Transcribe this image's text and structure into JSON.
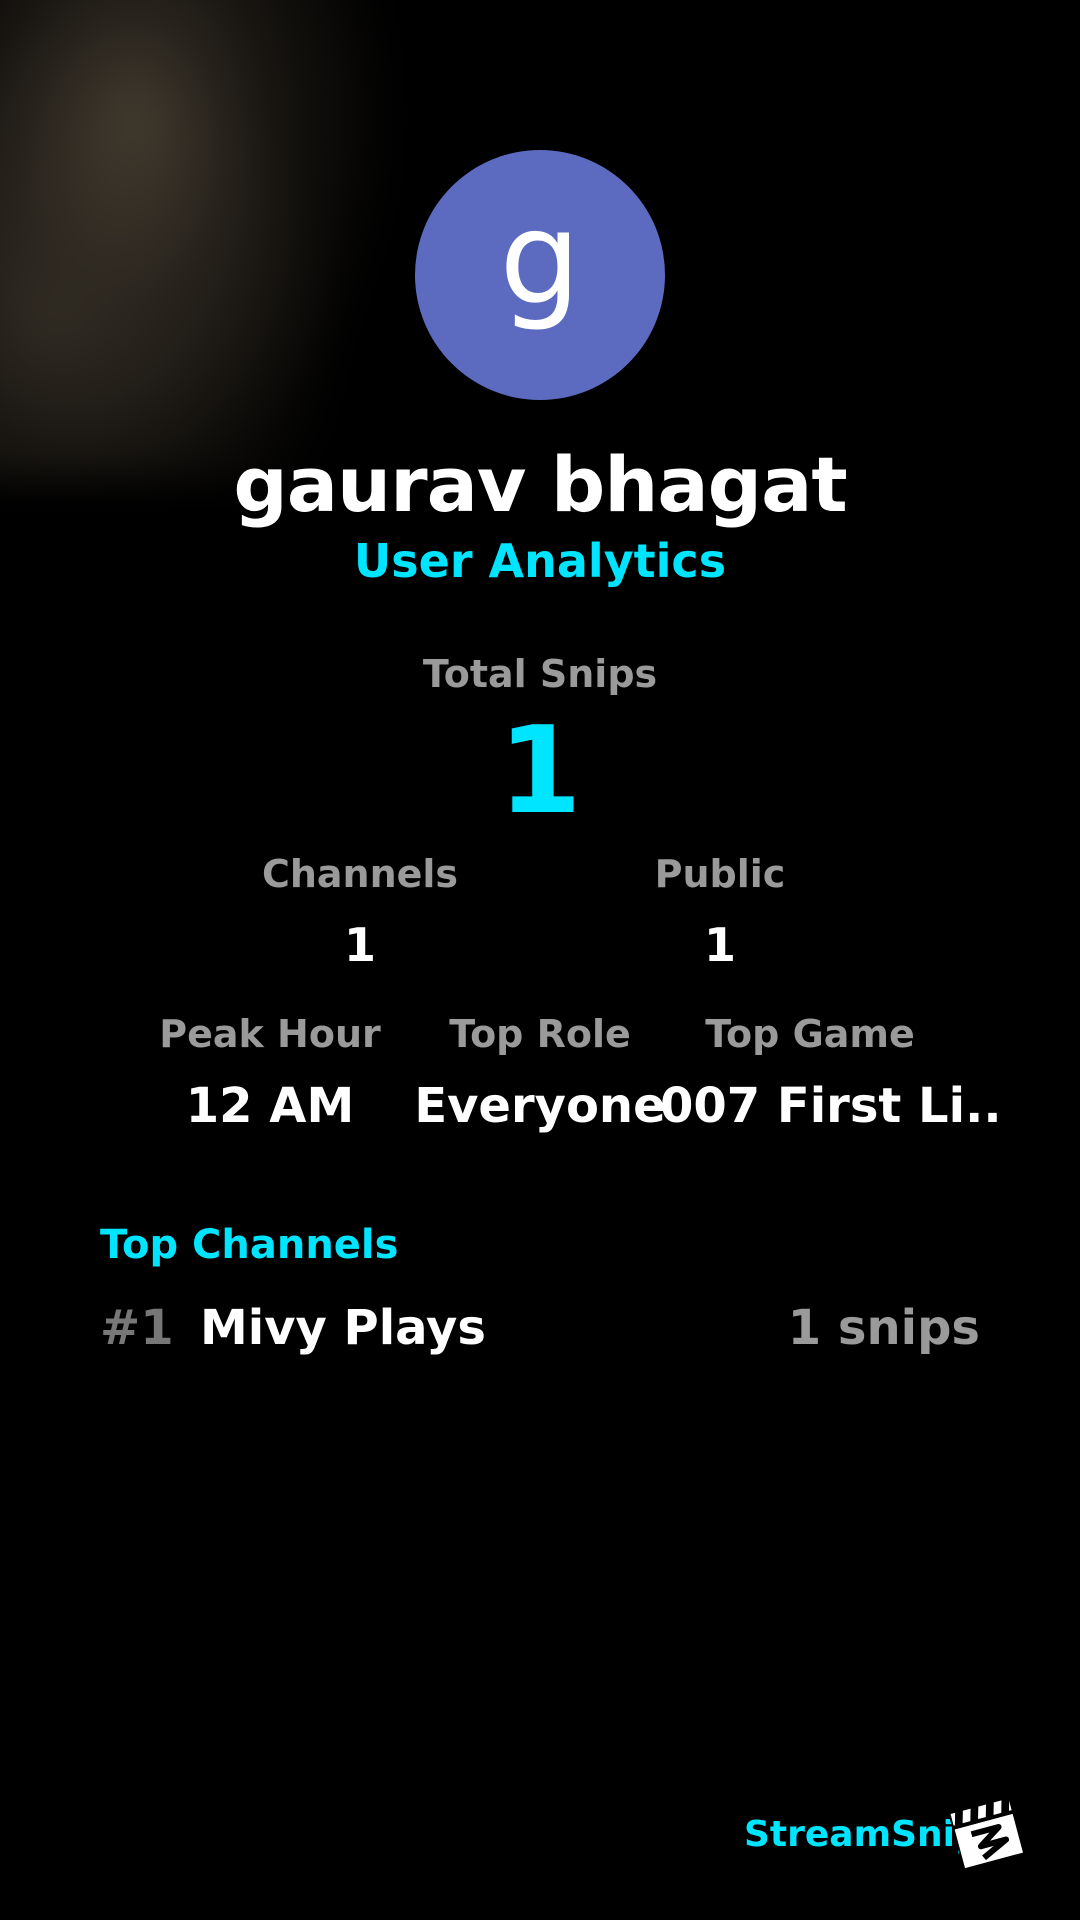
{
  "profile": {
    "avatar_letter": "g",
    "avatar_color": "#5c6bc0",
    "name": "gaurav bhagat",
    "subtitle": "User Analytics"
  },
  "totals": {
    "label": "Total Snips",
    "value": "1"
  },
  "stats_row1": {
    "channels_label": "Channels",
    "channels_value": "1",
    "public_label": "Public",
    "public_value": "1"
  },
  "stats_row2": {
    "peak_hour_label": "Peak Hour",
    "peak_hour_value": "12 AM",
    "top_role_label": "Top Role",
    "top_role_value": "Everyone",
    "top_game_label": "Top Game",
    "top_game_value": "007 First Li.."
  },
  "top_channels": {
    "title": "Top Channels",
    "items": [
      {
        "rank": "#1",
        "name": "Mivy Plays",
        "count": "1 snips"
      }
    ]
  },
  "branding": {
    "name": "StreamSnip",
    "logo_icon": "clapperboard-icon"
  },
  "colors": {
    "accent": "#00e5ff",
    "muted": "#9a9a9a",
    "background": "#000000"
  }
}
